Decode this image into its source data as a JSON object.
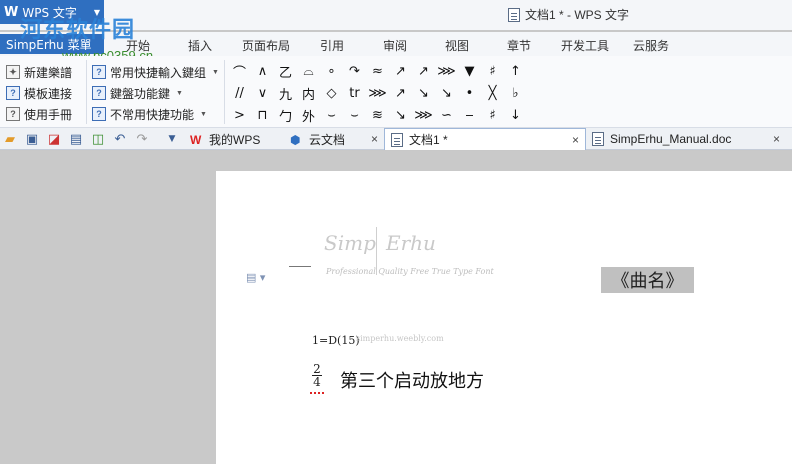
{
  "app": {
    "brand_label": "WPS 文字",
    "window_title": "文档1 * - WPS 文字",
    "watermark_site": "河东软件园",
    "watermark_url": "www.pc0359.cn"
  },
  "menu": {
    "app_menu_label": "SimpErhu 菜單",
    "tabs": [
      "开始",
      "插入",
      "页面布局",
      "引用",
      "审阅",
      "视图",
      "章节",
      "开发工具",
      "云服务"
    ]
  },
  "ribbon": {
    "left_col": [
      "新建樂譜",
      "模板連接",
      "使用手冊"
    ],
    "mid_col": [
      "常用快捷輸入鍵组",
      "鍵盤功能鍵",
      "不常用快捷功能"
    ],
    "symbols": [
      [
        "⌒",
        "∧",
        "⼄",
        "⌓",
        "∘",
        "↷",
        "≈",
        "↗",
        "↗",
        "⋙",
        "▼",
        "♯",
        "↑",
        "♮"
      ],
      [
        "//",
        "∨",
        "九",
        "内",
        "◇",
        "tr",
        "⋙",
        "↗",
        "↘",
        "↘",
        "•",
        "╳",
        "♭",
        "↶"
      ],
      [
        ">",
        "⊓",
        "勹",
        "外",
        "⌣",
        "⌣",
        "≋",
        "↘",
        "⋙",
        "∽",
        "‒",
        "♯",
        "↓",
        "↝"
      ]
    ]
  },
  "tabs": {
    "items": [
      {
        "label": "我的WPS"
      },
      {
        "label": "云文档"
      },
      {
        "label": "文档1 *"
      },
      {
        "label": "SimpErhu_Manual.doc"
      }
    ],
    "close_glyph": "×"
  },
  "document": {
    "logo_left": "Simp",
    "logo_right": "Erhu",
    "logo_arc_text": "Professional Quality Free True Type Font",
    "title_box": "《曲名》",
    "key_signature": "1=D(15)",
    "logo_url": "simperhu.weebly.com",
    "time_sig_top": "2",
    "time_sig_bottom": "4",
    "lyric_line": "第三个启动放地方"
  },
  "colors": {
    "accent": "#2f6fc0",
    "watermark_blue": "#2a82d8",
    "watermark_green": "#3a8e2f"
  }
}
